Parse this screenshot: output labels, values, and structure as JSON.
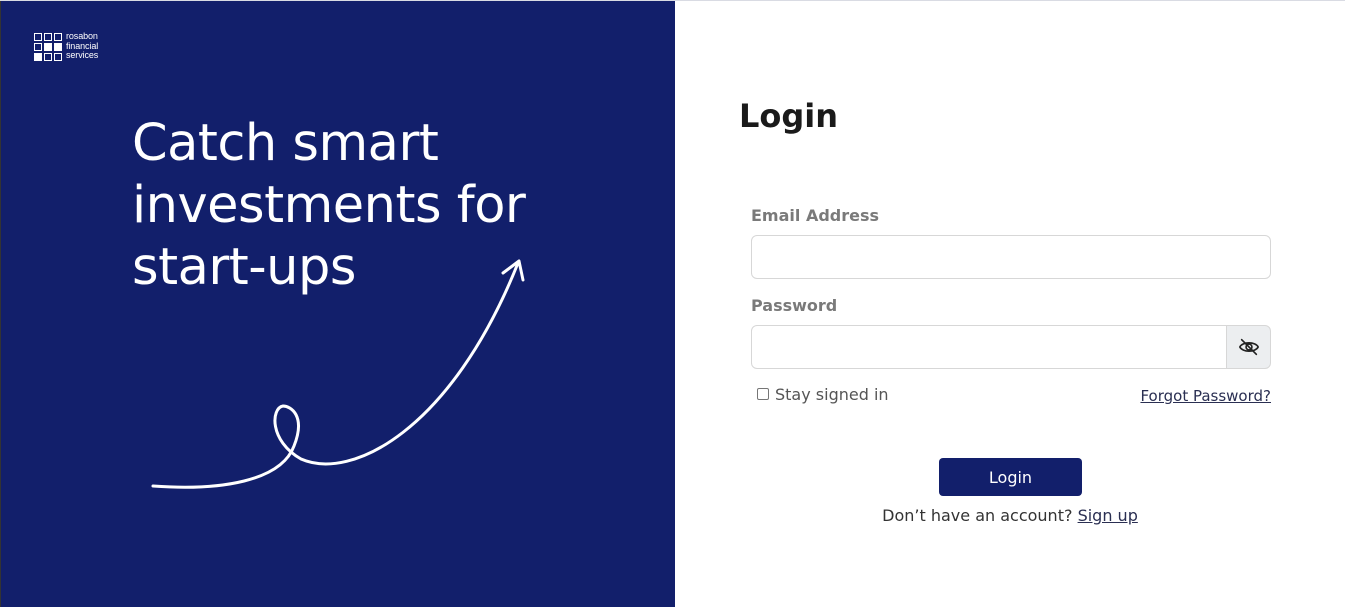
{
  "brand": {
    "logo_lines": [
      "rosabon",
      "financial",
      "services"
    ],
    "primary_color": "#121f6b"
  },
  "hero": {
    "headline_lines": [
      "Catch smart",
      "investments for",
      "start-ups"
    ]
  },
  "form": {
    "title": "Login",
    "email_label": "Email Address",
    "email_value": "",
    "password_label": "Password",
    "password_value": "",
    "toggle_icon": "eye-off-icon",
    "stay_signed_in_label": "Stay signed in",
    "stay_signed_in_checked": false,
    "forgot_password_label": "Forgot Password?",
    "login_button_label": "Login",
    "signup_prompt": "Don’t have an account?",
    "signup_link_label": "Sign up"
  }
}
